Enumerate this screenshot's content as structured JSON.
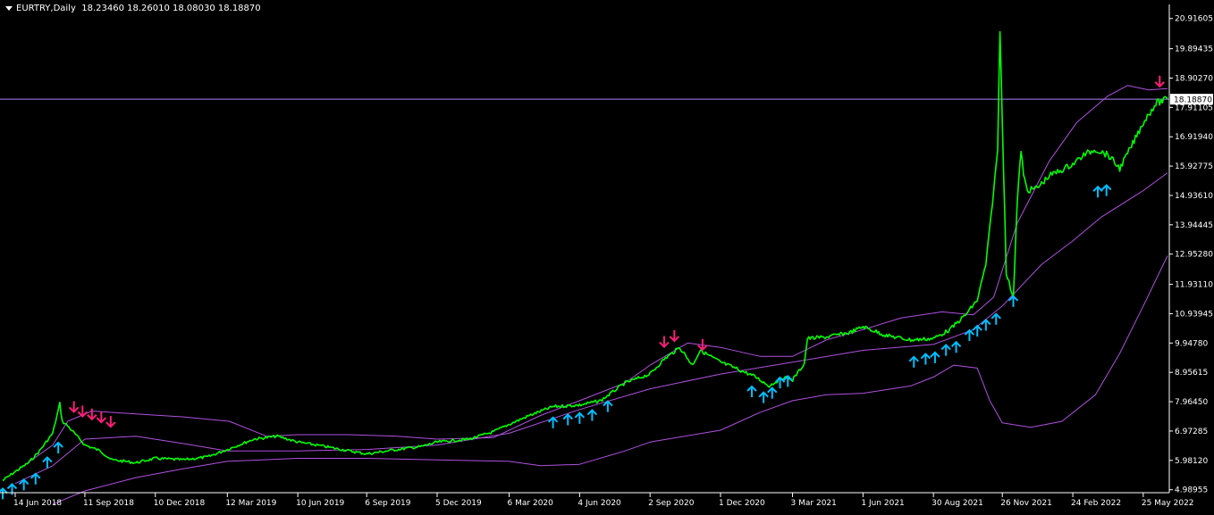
{
  "header": {
    "symbol": "EURTRY,Daily",
    "ohlc": "18.23460 18.26010 18.08030 18.18870"
  },
  "chart_data": {
    "type": "line",
    "colors": {
      "background": "#000000",
      "price": "#00ff00",
      "bands": "#b050e0",
      "buy_arrow": "#00bfff",
      "sell_arrow": "#ff1e78",
      "axis": "#ffffff",
      "current_line": "#b080ff"
    },
    "ylim": [
      4.95,
      21.3
    ],
    "current_price_label": "18.18870",
    "current_price": 18.1887,
    "y_ticks": [
      20.91605,
      19.89435,
      18.9027,
      17.91105,
      16.9194,
      15.92775,
      14.9361,
      13.94445,
      12.9528,
      11.9311,
      10.93945,
      9.9478,
      8.95615,
      7.9645,
      6.97285,
      5.9812,
      4.98955
    ],
    "y_tick_labels": [
      "20.91605",
      "19.89435",
      "18.90270",
      "17.91105",
      "16.91940",
      "15.92775",
      "14.93610",
      "13.94445",
      "12.95280",
      "11.93110",
      "10.93945",
      "9.94780",
      "8.95615",
      "7.96450",
      "6.97285",
      "5.98120",
      "4.98955"
    ],
    "x_range": [
      "2018-05-29",
      "2022-06-25"
    ],
    "x_ticks": [
      "2018-06-14",
      "2018-09-11",
      "2018-12-10",
      "2019-03-12",
      "2019-06-10",
      "2019-09-06",
      "2019-12-05",
      "2020-03-06",
      "2020-06-04",
      "2020-09-02",
      "2020-12-01",
      "2021-03-03",
      "2021-06-01",
      "2021-08-30",
      "2021-11-26",
      "2022-02-24",
      "2022-05-25"
    ],
    "x_tick_labels": [
      "14 Jun 2018",
      "11 Sep 2018",
      "10 Dec 2018",
      "12 Mar 2019",
      "10 Jun 2019",
      "6 Sep 2019",
      "5 Dec 2019",
      "6 Mar 2020",
      "4 Jun 2020",
      "2 Sep 2020",
      "1 Dec 2020",
      "3 Mar 2021",
      "1 Jun 2021",
      "30 Aug 2021",
      "26 Nov 2021",
      "24 Feb 2022",
      "25 May 2022"
    ],
    "series": [
      {
        "key": "price",
        "x": [
          "2018-05-29",
          "2018-06-14",
          "2018-07-01",
          "2018-07-15",
          "2018-08-01",
          "2018-08-10",
          "2018-08-13",
          "2018-08-20",
          "2018-09-01",
          "2018-09-11",
          "2018-10-01",
          "2018-10-15",
          "2018-11-01",
          "2018-11-15",
          "2018-12-10",
          "2019-01-15",
          "2019-02-15",
          "2019-03-12",
          "2019-04-15",
          "2019-05-15",
          "2019-06-10",
          "2019-07-15",
          "2019-08-15",
          "2019-09-06",
          "2019-10-15",
          "2019-11-15",
          "2019-12-05",
          "2020-01-15",
          "2020-02-15",
          "2020-03-06",
          "2020-04-01",
          "2020-05-01",
          "2020-06-04",
          "2020-07-01",
          "2020-08-01",
          "2020-09-02",
          "2020-09-20",
          "2020-10-10",
          "2020-10-26",
          "2020-11-05",
          "2020-12-01",
          "2020-12-20",
          "2021-01-15",
          "2021-02-01",
          "2021-02-20",
          "2021-03-03",
          "2021-03-18",
          "2021-03-22",
          "2021-04-15",
          "2021-05-15",
          "2021-06-01",
          "2021-07-01",
          "2021-08-01",
          "2021-08-30",
          "2021-09-20",
          "2021-10-10",
          "2021-10-25",
          "2021-11-05",
          "2021-11-15",
          "2021-11-20",
          "2021-11-23",
          "2021-12-01",
          "2021-12-10",
          "2021-12-15",
          "2021-12-20",
          "2021-12-23",
          "2021-12-28",
          "2022-01-10",
          "2022-01-25",
          "2022-02-10",
          "2022-02-24",
          "2022-03-10",
          "2022-03-25",
          "2022-04-10",
          "2022-04-25",
          "2022-05-10",
          "2022-05-25",
          "2022-06-10",
          "2022-06-25"
        ],
        "y": [
          5.3,
          5.6,
          5.9,
          6.3,
          6.9,
          7.9,
          7.3,
          7.15,
          6.8,
          6.5,
          6.3,
          6.0,
          5.95,
          5.9,
          6.05,
          6.0,
          6.1,
          6.35,
          6.7,
          6.8,
          6.6,
          6.45,
          6.3,
          6.2,
          6.35,
          6.45,
          6.6,
          6.7,
          6.95,
          7.2,
          7.5,
          7.8,
          7.85,
          8.0,
          8.6,
          8.9,
          9.4,
          9.8,
          9.2,
          9.7,
          9.3,
          9.1,
          8.8,
          8.5,
          8.8,
          8.7,
          9.25,
          10.1,
          10.15,
          10.3,
          10.5,
          10.2,
          10.05,
          10.1,
          10.4,
          10.9,
          11.4,
          12.6,
          15.1,
          16.5,
          20.6,
          12.3,
          11.5,
          14.7,
          16.5,
          15.6,
          15.1,
          15.2,
          15.6,
          15.8,
          16.0,
          16.3,
          16.5,
          16.3,
          15.85,
          16.6,
          17.4,
          18.05,
          18.19
        ]
      },
      {
        "key": "band-upper",
        "x": [
          "2018-06-14",
          "2018-08-01",
          "2018-08-20",
          "2018-09-20",
          "2018-11-15",
          "2019-01-15",
          "2019-03-15",
          "2019-05-01",
          "2019-06-10",
          "2019-08-15",
          "2019-10-15",
          "2019-12-05",
          "2020-02-15",
          "2020-04-15",
          "2020-06-04",
          "2020-08-01",
          "2020-09-02",
          "2020-10-20",
          "2020-12-01",
          "2021-01-20",
          "2021-03-03",
          "2021-04-15",
          "2021-06-01",
          "2021-07-20",
          "2021-09-10",
          "2021-10-20",
          "2021-11-15",
          "2021-12-15",
          "2022-01-25",
          "2022-03-01",
          "2022-04-10",
          "2022-05-05",
          "2022-06-01",
          "2022-06-25"
        ],
        "y": [
          5.6,
          6.5,
          7.3,
          7.65,
          7.55,
          7.45,
          7.3,
          6.8,
          6.85,
          6.85,
          6.8,
          6.7,
          6.75,
          7.5,
          8.0,
          8.6,
          9.2,
          9.95,
          9.8,
          9.5,
          9.5,
          10.05,
          10.4,
          10.8,
          11.0,
          10.9,
          11.5,
          14.0,
          16.1,
          17.4,
          18.3,
          18.65,
          18.5,
          18.55
        ]
      },
      {
        "key": "band-middle",
        "x": [
          "2018-06-14",
          "2018-08-01",
          "2018-09-11",
          "2018-11-15",
          "2019-01-15",
          "2019-03-12",
          "2019-06-10",
          "2019-09-06",
          "2019-12-05",
          "2020-03-06",
          "2020-06-04",
          "2020-09-02",
          "2020-12-01",
          "2021-03-03",
          "2021-06-01",
          "2021-08-30",
          "2021-10-20",
          "2021-11-26",
          "2022-01-15",
          "2022-02-24",
          "2022-04-01",
          "2022-05-25",
          "2022-06-25"
        ],
        "y": [
          5.2,
          5.8,
          6.7,
          6.8,
          6.55,
          6.3,
          6.3,
          6.35,
          6.5,
          6.9,
          7.7,
          8.4,
          8.9,
          9.3,
          9.7,
          9.9,
          10.4,
          11.2,
          12.6,
          13.4,
          14.2,
          15.1,
          15.7
        ]
      },
      {
        "key": "band-lower",
        "x": [
          "2018-08-01",
          "2018-09-11",
          "2018-11-15",
          "2019-01-15",
          "2019-03-12",
          "2019-06-10",
          "2019-09-06",
          "2019-12-05",
          "2020-03-06",
          "2020-04-15",
          "2020-06-04",
          "2020-08-01",
          "2020-09-02",
          "2020-12-01",
          "2021-01-20",
          "2021-03-03",
          "2021-04-15",
          "2021-06-01",
          "2021-08-01",
          "2021-08-30",
          "2021-09-25",
          "2021-10-25",
          "2021-11-10",
          "2021-11-26",
          "2022-01-01",
          "2022-02-10",
          "2022-03-25",
          "2022-04-25",
          "2022-05-25",
          "2022-06-25"
        ],
        "y": [
          4.5,
          4.95,
          5.4,
          5.7,
          5.95,
          6.05,
          6.05,
          6.0,
          5.95,
          5.8,
          5.85,
          6.3,
          6.6,
          7.0,
          7.6,
          8.0,
          8.2,
          8.25,
          8.5,
          8.8,
          9.2,
          9.1,
          8.0,
          7.25,
          7.1,
          7.3,
          8.2,
          9.6,
          11.2,
          12.9
        ]
      }
    ],
    "buy_signals": [
      {
        "x": "2018-05-29",
        "y": 5.15
      },
      {
        "x": "2018-06-10",
        "y": 5.3
      },
      {
        "x": "2018-06-25",
        "y": 5.45
      },
      {
        "x": "2018-07-10",
        "y": 5.65
      },
      {
        "x": "2018-07-25",
        "y": 6.2
      },
      {
        "x": "2018-08-08",
        "y": 6.7
      },
      {
        "x": "2020-05-01",
        "y": 7.55
      },
      {
        "x": "2020-05-20",
        "y": 7.65
      },
      {
        "x": "2020-06-04",
        "y": 7.7
      },
      {
        "x": "2020-06-20",
        "y": 7.8
      },
      {
        "x": "2020-07-10",
        "y": 8.1
      },
      {
        "x": "2021-01-10",
        "y": 8.6
      },
      {
        "x": "2021-01-25",
        "y": 8.4
      },
      {
        "x": "2021-02-05",
        "y": 8.55
      },
      {
        "x": "2021-02-15",
        "y": 8.9
      },
      {
        "x": "2021-02-25",
        "y": 8.95
      },
      {
        "x": "2021-08-05",
        "y": 9.6
      },
      {
        "x": "2021-08-20",
        "y": 9.7
      },
      {
        "x": "2021-09-01",
        "y": 9.75
      },
      {
        "x": "2021-09-15",
        "y": 10.0
      },
      {
        "x": "2021-09-28",
        "y": 10.1
      },
      {
        "x": "2021-10-15",
        "y": 10.5
      },
      {
        "x": "2021-10-25",
        "y": 10.65
      },
      {
        "x": "2021-11-05",
        "y": 10.85
      },
      {
        "x": "2021-11-18",
        "y": 11.05
      },
      {
        "x": "2021-12-10",
        "y": 11.65
      },
      {
        "x": "2022-03-28",
        "y": 15.35
      },
      {
        "x": "2022-04-08",
        "y": 15.4
      }
    ],
    "sell_signals": [
      {
        "x": "2018-08-28",
        "y": 7.5
      },
      {
        "x": "2018-09-08",
        "y": 7.35
      },
      {
        "x": "2018-09-20",
        "y": 7.25
      },
      {
        "x": "2018-10-02",
        "y": 7.15
      },
      {
        "x": "2018-10-14",
        "y": 7.0
      },
      {
        "x": "2020-09-20",
        "y": 9.7
      },
      {
        "x": "2020-10-03",
        "y": 9.9
      },
      {
        "x": "2020-11-08",
        "y": 9.6
      },
      {
        "x": "2022-06-15",
        "y": 18.5
      }
    ]
  }
}
